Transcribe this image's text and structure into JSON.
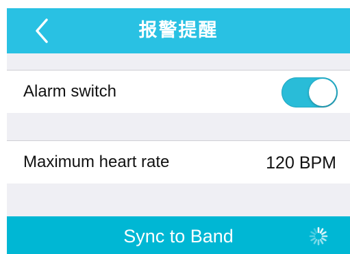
{
  "nav": {
    "title": "报警提醒",
    "back_icon": "chevron-left-icon"
  },
  "settings": {
    "alarm_switch": {
      "label": "Alarm switch",
      "state": "on"
    },
    "max_heart_rate": {
      "label": "Maximum heart rate",
      "value": "120 BPM"
    }
  },
  "sync": {
    "label": "Sync to Band",
    "spinner_icon": "loading-spinner-icon"
  },
  "colors": {
    "nav_bar": "#29C1E3",
    "toggle_on": "#29BCD8",
    "sync_bar": "#00B7D4",
    "separator": "#EFEFF4"
  }
}
